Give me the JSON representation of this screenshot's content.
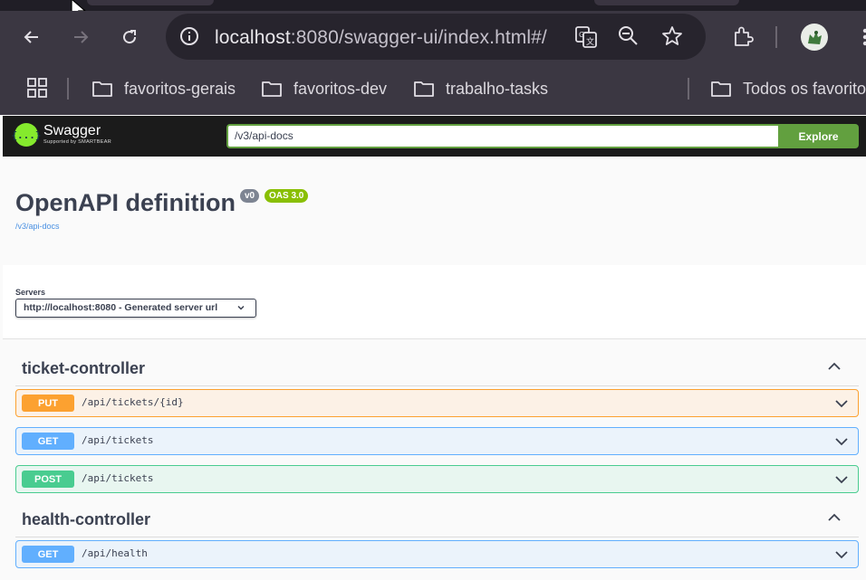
{
  "browser": {
    "url_host": "localhost",
    "url_rest": ":8080/swagger-ui/index.html#/",
    "icons": [
      "back-icon",
      "forward-icon",
      "reload-icon",
      "site-info-icon",
      "translate-icon",
      "zoom-icon",
      "star-icon",
      "extensions-icon",
      "profile-avatar",
      "menu-icon"
    ],
    "bookmarks": [
      "favoritos-gerais",
      "favoritos-dev",
      "trabalho-tasks"
    ],
    "all_bookmarks": "Todos os favorito"
  },
  "swagger": {
    "logo_text": "Swagger",
    "logo_sub": "Supported by SMARTBEAR",
    "logo_mark": "{...}",
    "search_value": "/v3/api-docs",
    "explore_label": "Explore",
    "colors": {
      "topbar": "#1b1b1b",
      "accent": "#62a03f",
      "put": "#fca130",
      "get": "#61affe",
      "post": "#49cc90"
    }
  },
  "info": {
    "title": "OpenAPI definition",
    "version": "v0",
    "oas": "OAS 3.0",
    "spec_link": "/v3/api-docs"
  },
  "servers": {
    "label": "Servers",
    "selected": "http://localhost:8080 - Generated server url"
  },
  "tags": [
    {
      "name": "ticket-controller",
      "ops": [
        {
          "method": "PUT",
          "path": "/api/tickets/{id}"
        },
        {
          "method": "GET",
          "path": "/api/tickets"
        },
        {
          "method": "POST",
          "path": "/api/tickets"
        }
      ]
    },
    {
      "name": "health-controller",
      "ops": [
        {
          "method": "GET",
          "path": "/api/health"
        }
      ]
    }
  ]
}
